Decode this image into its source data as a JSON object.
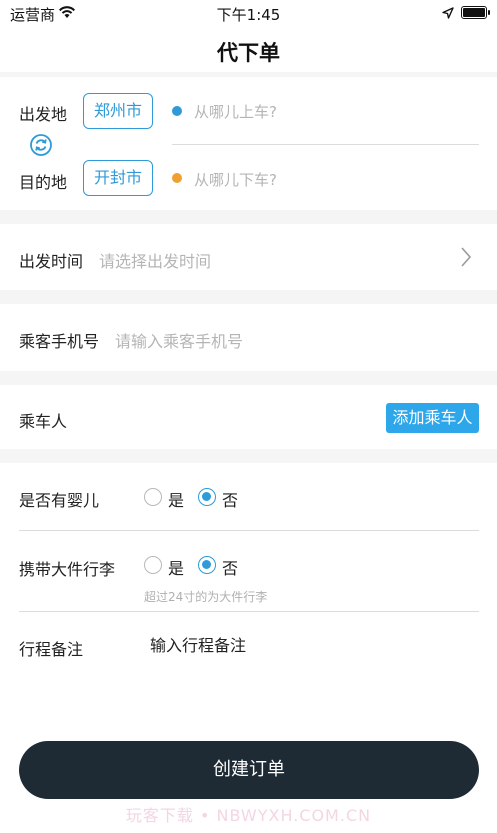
{
  "status_bar": {
    "carrier": "运营商",
    "time": "下午1:45"
  },
  "nav": {
    "title": "代下单"
  },
  "route": {
    "departure_label": "出发地",
    "departure_city": "郑州市",
    "pickup_placeholder": "从哪儿上车?",
    "destination_label": "目的地",
    "destination_city": "开封市",
    "dropoff_placeholder": "从哪儿下车?",
    "pickup_dot_color": "#2e9bd8",
    "dropoff_dot_color": "#f0a030"
  },
  "departure_time": {
    "label": "出发时间",
    "placeholder": "请选择出发时间"
  },
  "phone": {
    "label": "乘客手机号",
    "placeholder": "请输入乘客手机号"
  },
  "passenger": {
    "label": "乘车人",
    "add_button": "添加乘车人"
  },
  "infant": {
    "label": "是否有婴儿",
    "yes": "是",
    "no": "否",
    "selected": "否"
  },
  "luggage": {
    "label": "携带大件行李",
    "yes": "是",
    "no": "否",
    "selected": "否",
    "hint": "超过24寸的为大件行李"
  },
  "remark": {
    "label": "行程备注",
    "placeholder": "输入行程备注"
  },
  "actions": {
    "create_order": "创建订单"
  },
  "watermark": "玩客下载 • NBWYXH.COM.CN",
  "colors": {
    "accent": "#2e9bd8",
    "button_dark": "#1e2b35",
    "add_button": "#2ea6ea"
  }
}
